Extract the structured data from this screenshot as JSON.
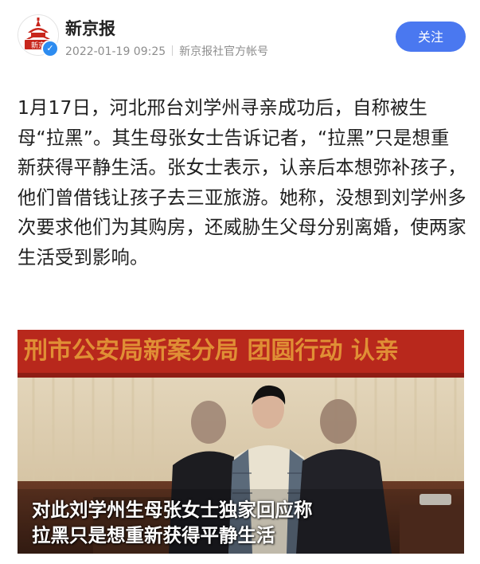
{
  "header": {
    "account_name": "新京报",
    "avatar_logo_text": "新京",
    "date": "2022-01-19 09:25",
    "account_type": "新京报社官方帐号",
    "follow_label": "关注"
  },
  "article": {
    "body": "1月17日，河北邢台刘学州寻亲成功后，自称被生母“拉黑”。其生母张女士告诉记者，“拉黑”只是想重新获得平静生活。张女士表示，认亲后本想弥补孩子，他们曾借钱让孩子去三亚旅游。她称，没想到刘学州多次要求他们为其购房，还威胁生父母分别离婚，使两家生活受到影响。"
  },
  "photo": {
    "banner_text": "刑市公安局新案分局  团圆行动  认亲",
    "caption_line1": "对此刘学州生母张女士独家回应称",
    "caption_line2": "拉黑只是想重新获得平静生活"
  },
  "colors": {
    "accent": "#4a78f0",
    "banner_red": "#b8281c",
    "text": "#202020",
    "meta": "#8d8d8d"
  }
}
